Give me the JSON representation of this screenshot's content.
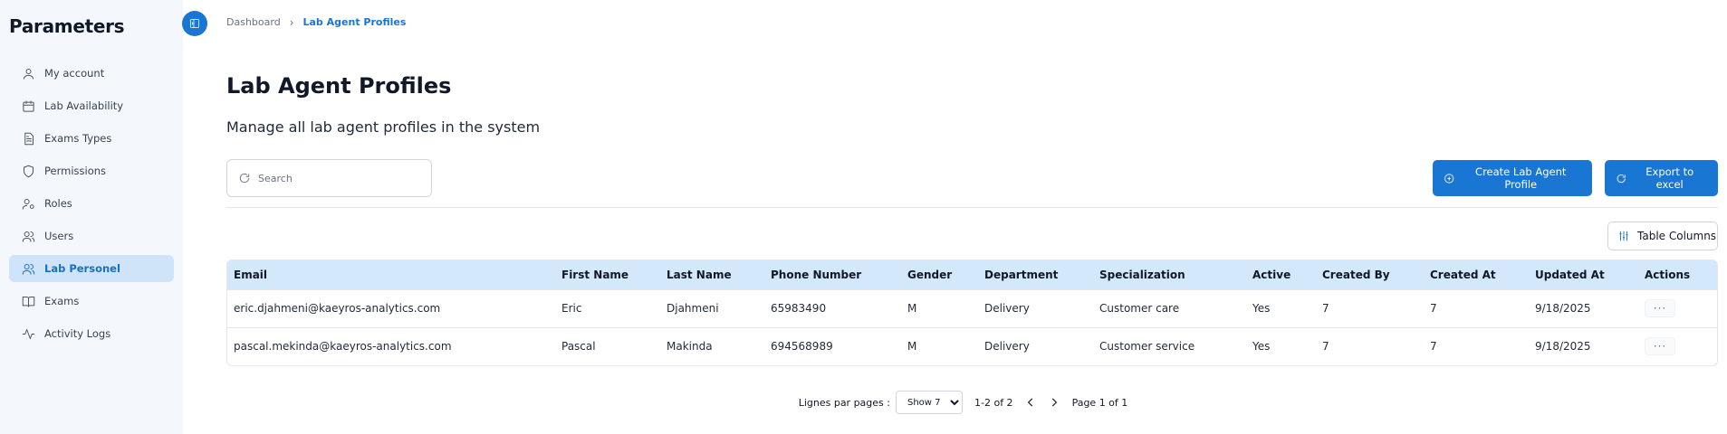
{
  "sidebar": {
    "title": "Parameters",
    "items": [
      {
        "label": "My account",
        "icon": "user-icon"
      },
      {
        "label": "Lab Availability",
        "icon": "calendar-icon"
      },
      {
        "label": "Exams Types",
        "icon": "document-icon"
      },
      {
        "label": "Permissions",
        "icon": "shield-icon"
      },
      {
        "label": "Roles",
        "icon": "user-cog-icon"
      },
      {
        "label": "Users",
        "icon": "users-icon"
      },
      {
        "label": "Lab Personel",
        "icon": "users-icon",
        "active": true
      },
      {
        "label": "Exams",
        "icon": "book-icon"
      },
      {
        "label": "Activity Logs",
        "icon": "activity-icon"
      }
    ]
  },
  "breadcrumb": {
    "home": "Dashboard",
    "separator": "›",
    "current": "Lab Agent Profiles"
  },
  "page": {
    "title": "Lab Agent Profiles",
    "subtitle": "Manage all lab agent profiles in the system"
  },
  "search": {
    "placeholder": "Search",
    "value": ""
  },
  "buttons": {
    "create": "Create Lab Agent Profile",
    "export": "Export to excel",
    "columns": "Table Columns"
  },
  "table": {
    "headers": [
      "Email",
      "First Name",
      "Last Name",
      "Phone Number",
      "Gender",
      "Department",
      "Specialization",
      "Active",
      "Created By",
      "Created At",
      "Updated At",
      "Actions"
    ],
    "rows": [
      {
        "email": "eric.djahmeni@kaeyros-analytics.com",
        "first_name": "Eric",
        "last_name": "Djahmeni",
        "phone": "65983490",
        "gender": "M",
        "department": "Delivery",
        "specialization": "Customer care",
        "active": "Yes",
        "created_by": "7",
        "created_at": "7",
        "updated_at": "9/18/2025",
        "actions": "···"
      },
      {
        "email": "pascal.mekinda@kaeyros-analytics.com",
        "first_name": "Pascal",
        "last_name": "Makinda",
        "phone": "694568989",
        "gender": "M",
        "department": "Delivery",
        "specialization": "Customer service",
        "active": "Yes",
        "created_by": "7",
        "created_at": "7",
        "updated_at": "9/18/2025",
        "actions": "···"
      }
    ]
  },
  "pagination": {
    "rows_label": "Lignes par pages :",
    "rows_option": "Show 7",
    "range": "1-2 of 2",
    "page_info": "Page 1 of 1"
  },
  "colors": {
    "accent": "#1976d2",
    "active_bg": "#cfe4f8",
    "header_bg": "#d4e8fb",
    "sidebar_bg": "#f4f8fc"
  }
}
